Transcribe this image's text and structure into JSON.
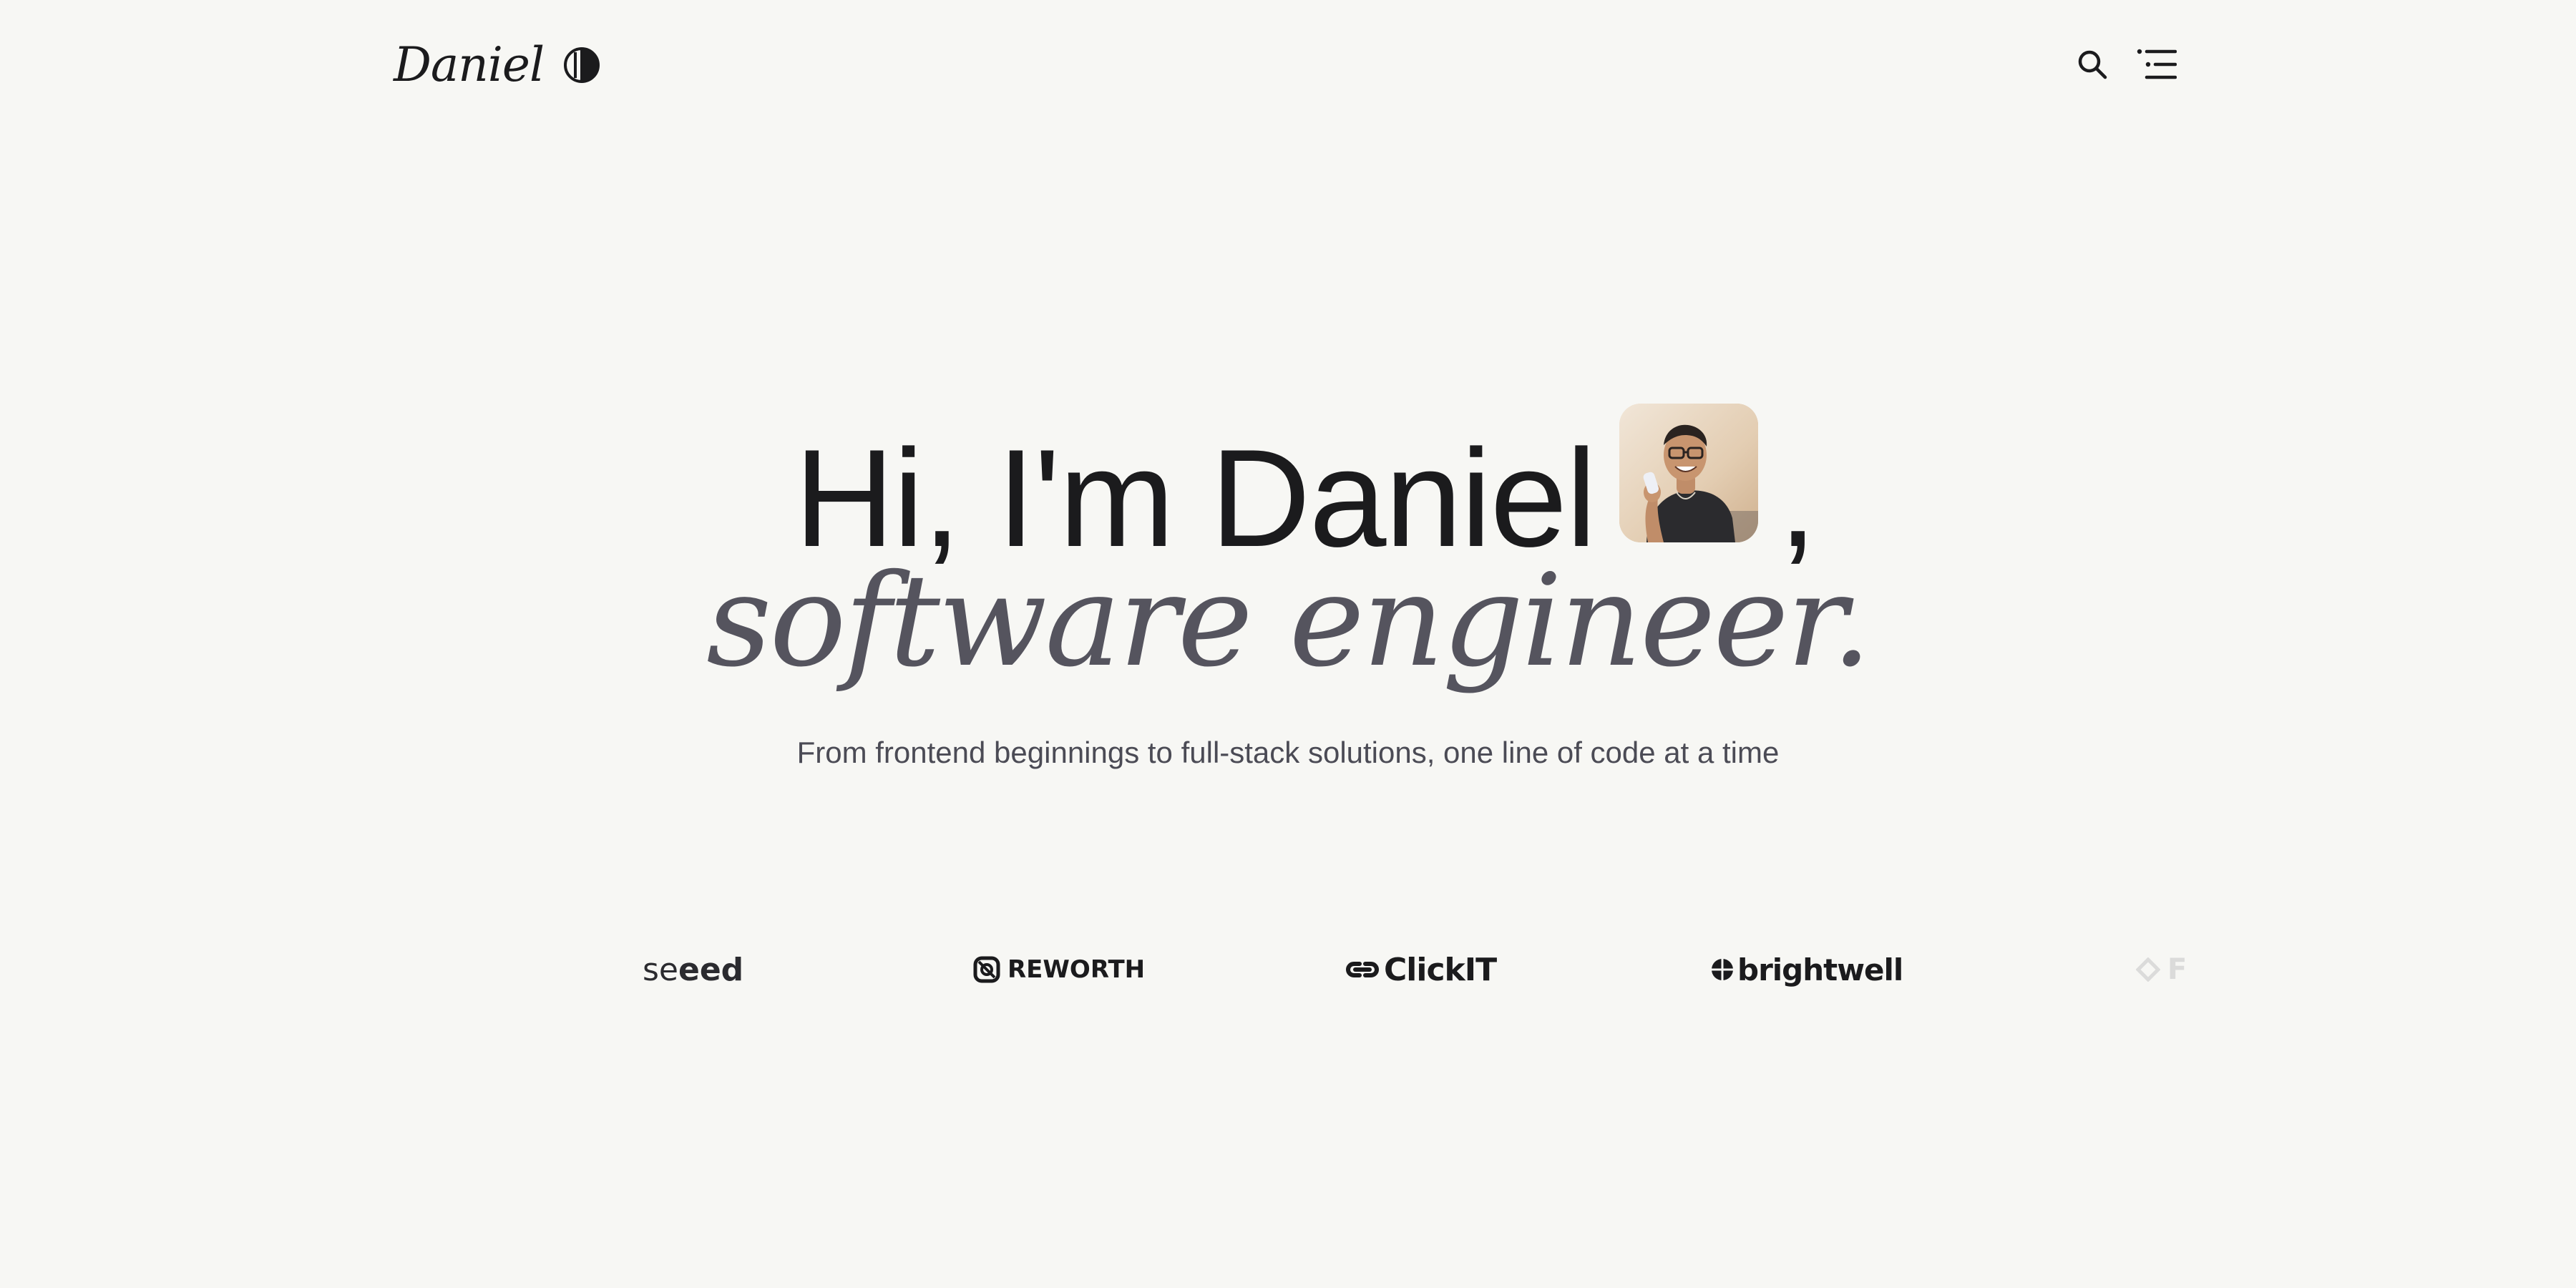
{
  "header": {
    "brand_name": "Daniel",
    "theme_toggle_icon": "half-circle-toggle-icon",
    "search_icon": "search-icon",
    "menu_icon": "menu-icon"
  },
  "hero": {
    "greeting": "Hi, I'm Daniel",
    "comma": ",",
    "role": "software engineer.",
    "subtitle": "From frontend beginnings to full-stack solutions, one line of code at a time"
  },
  "logos": [
    {
      "name": "seeed",
      "text_light": "se",
      "text_bold": "eed"
    },
    {
      "name": "reworth",
      "text": "REWORTH"
    },
    {
      "name": "clickit",
      "text": "ClickIT"
    },
    {
      "name": "brightwell",
      "text": "brightwell"
    },
    {
      "name": "faded-logo",
      "text": "F"
    }
  ],
  "colors": {
    "background": "#f7f7f4",
    "text": "#1b1b1d",
    "muted_italic": "#55545e",
    "subtitle": "#4b4b55"
  }
}
